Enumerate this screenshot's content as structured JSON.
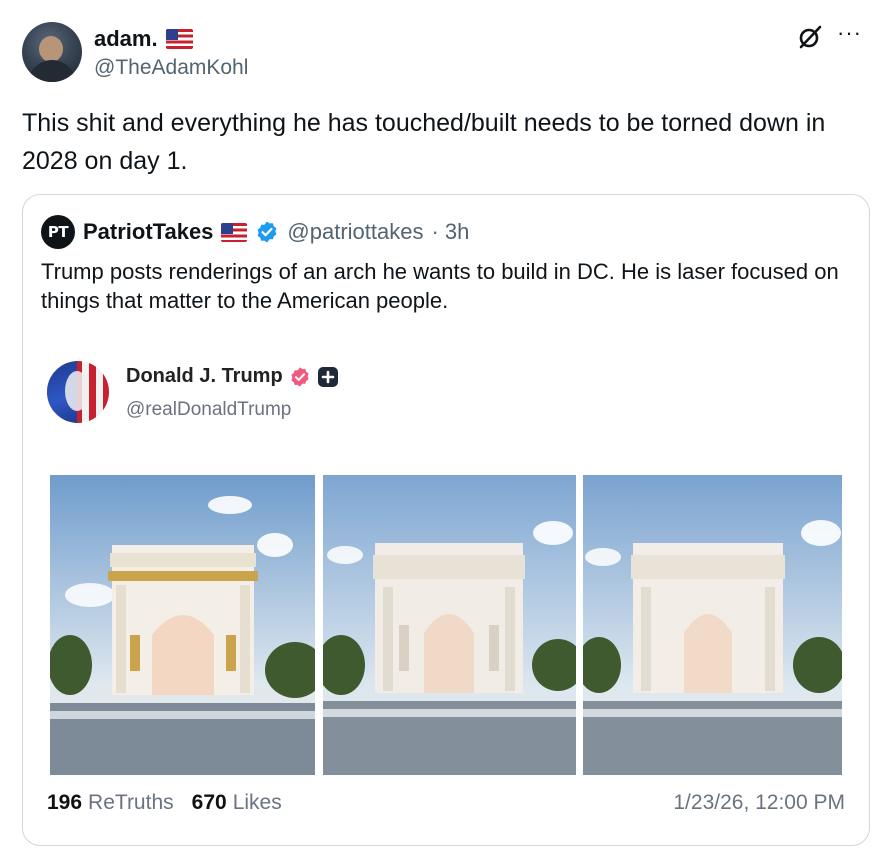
{
  "post": {
    "author": {
      "display_name": "adam.",
      "handle": "@TheAdamKohl",
      "flag_icon": "us-flag-icon"
    },
    "text": "This shit and everything he has touched/built needs to be torned down in 2028 on day 1.",
    "icons": {
      "grok": "grok-icon",
      "more": "more-icon",
      "more_glyph": "···"
    }
  },
  "quote": {
    "logo_text": "PT",
    "author": {
      "display_name": "PatriotTakes",
      "handle": "@patriottakes",
      "time": "· 3h",
      "verified": true
    },
    "text": "Trump posts renderings of an arch he wants to build in DC. He is laser focused on things that matter to the American people.",
    "embedded": {
      "author": {
        "display_name": "Donald J. Trump",
        "handle": "@realDonaldTrump"
      },
      "images": [
        {
          "alt": "arch-rendering-gold",
          "accent": "#c9a44a"
        },
        {
          "alt": "arch-rendering-white-statues",
          "accent": "#e8e2d6"
        },
        {
          "alt": "arch-rendering-white",
          "accent": "#ece7dd"
        }
      ],
      "stats": {
        "retruths_count": "196",
        "retruths_label": "ReTruths",
        "likes_count": "670",
        "likes_label": "Likes"
      },
      "date": "1/23/26, 12:00 PM"
    }
  },
  "colors": {
    "verified_blue": "#1d9bf0",
    "truth_badge": "#f05a7e",
    "secondary_text": "#536471",
    "border": "#cfd9de"
  }
}
